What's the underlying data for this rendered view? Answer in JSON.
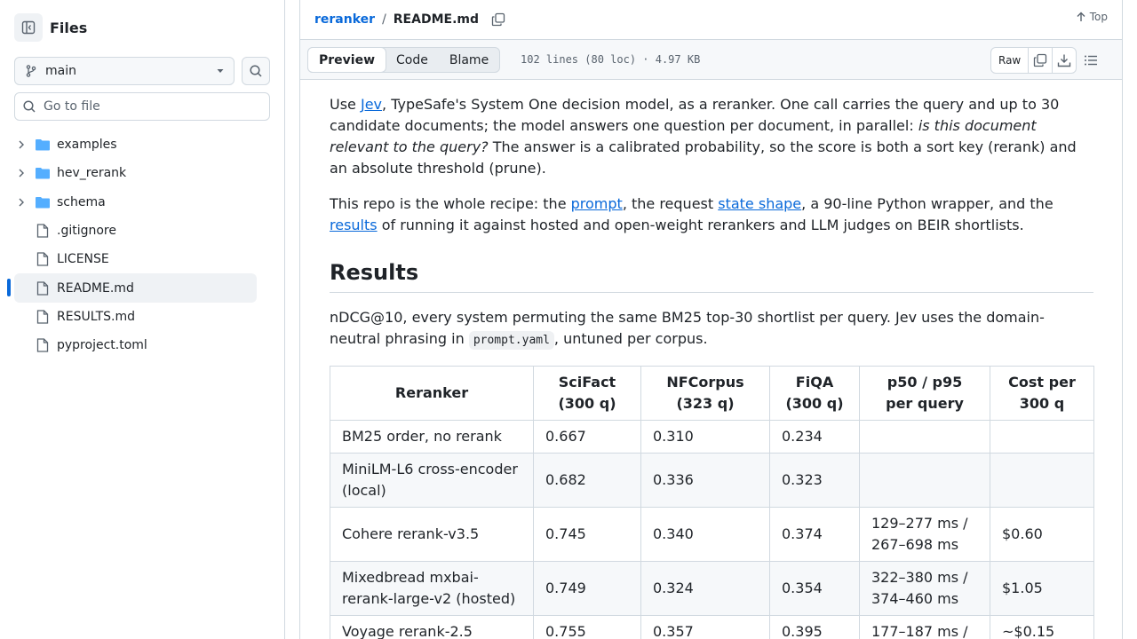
{
  "sidebar": {
    "title": "Files",
    "branch": "main",
    "goto_placeholder": "Go to file",
    "items": [
      {
        "type": "folder",
        "name": "examples"
      },
      {
        "type": "folder",
        "name": "hev_rerank"
      },
      {
        "type": "folder",
        "name": "schema"
      },
      {
        "type": "file",
        "name": ".gitignore"
      },
      {
        "type": "file",
        "name": "LICENSE"
      },
      {
        "type": "file",
        "name": "README.md",
        "active": true
      },
      {
        "type": "file",
        "name": "RESULTS.md"
      },
      {
        "type": "file",
        "name": "pyproject.toml"
      }
    ]
  },
  "header": {
    "repo": "reranker",
    "separator": "/",
    "file": "README.md",
    "top_label": "Top"
  },
  "toolbar": {
    "tabs": [
      "Preview",
      "Code",
      "Blame"
    ],
    "active_tab": "Preview",
    "file_info": "102 lines (80 loc) · 4.97 KB",
    "raw_label": "Raw"
  },
  "article": {
    "p1": {
      "t1": "Use ",
      "link": "Jev",
      "t2": ", TypeSafe's System One decision model, as a reranker. One call carries the query and up to 30 candidate documents; the model answers one question per document, in parallel: ",
      "em": "is this document relevant to the query?",
      "t3": " The answer is a calibrated probability, so the score is both a sort key (rerank) and an absolute threshold (prune)."
    },
    "p2": {
      "t1": "This repo is the whole recipe: the ",
      "link1": "prompt",
      "t2": ", the request ",
      "link2": "state shape",
      "t3": ", a 90-line Python wrapper, and the ",
      "link3": "results",
      "t4": " of running it against hosted and open-weight rerankers and LLM judges on BEIR shortlists."
    },
    "h2": "Results",
    "p3": {
      "t1": "nDCG@10, every system permuting the same BM25 top-30 shortlist per query. Jev uses the domain-neutral phrasing in ",
      "code": "prompt.yaml",
      "t2": ", untuned per corpus."
    },
    "table": {
      "headers": [
        [
          "Reranker",
          ""
        ],
        [
          "SciFact",
          "(300 q)"
        ],
        [
          "NFCorpus",
          "(323 q)"
        ],
        [
          "FiQA",
          "(300 q)"
        ],
        [
          "p50 / p95",
          "per query"
        ],
        [
          "Cost per",
          "300 q"
        ]
      ],
      "rows": [
        [
          "BM25 order, no rerank",
          "0.667",
          "0.310",
          "0.234",
          "",
          ""
        ],
        [
          "MiniLM-L6 cross-encoder (local)",
          "0.682",
          "0.336",
          "0.323",
          "",
          ""
        ],
        [
          "Cohere rerank-v3.5",
          "0.745",
          "0.340",
          "0.374",
          "129–277 ms / 267–698 ms",
          "$0.60"
        ],
        [
          "Mixedbread mxbai-rerank-large-v2 (hosted)",
          "0.749",
          "0.324",
          "0.354",
          "322–380 ms / 374–460 ms",
          "$1.05"
        ],
        [
          "Voyage rerank-2.5",
          "0.755",
          "0.357",
          "0.395",
          "177–187 ms /",
          "~$0.15"
        ]
      ]
    }
  }
}
